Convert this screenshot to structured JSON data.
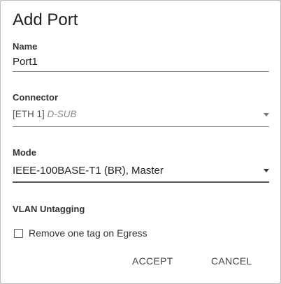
{
  "dialog": {
    "title": "Add Port",
    "name": {
      "label": "Name",
      "value": "Port1"
    },
    "connector": {
      "label": "Connector",
      "value_prefix": "[ETH 1]",
      "value_suffix": "D-SUB"
    },
    "mode": {
      "label": "Mode",
      "value": "IEEE-100BASE-T1 (BR), Master"
    },
    "vlan": {
      "label": "VLAN Untagging",
      "checkbox_label": "Remove one tag on Egress",
      "checked": false
    },
    "buttons": {
      "accept": "ACCEPT",
      "cancel": "CANCEL"
    }
  }
}
